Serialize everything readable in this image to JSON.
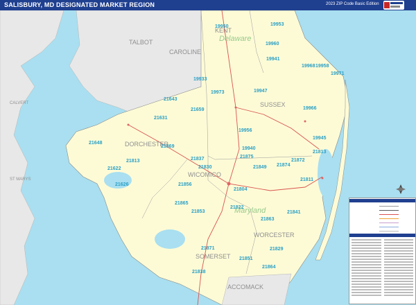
{
  "header": {
    "title": "SALISBURY, MD DESIGNATED MARKET REGION",
    "edition": "2023 ZIP Code Basic Edition"
  },
  "colors": {
    "land": "#fdfbd6",
    "other_land": "#e8e8e8",
    "water": "#a9dff0",
    "title_bar": "#1f3f8f",
    "zip_text": "#2a9fc5",
    "county_text": "#8f8f8f",
    "state_text": "#98c98a",
    "highway": "#d9534f"
  },
  "counties": [
    "KENT",
    "TALBOT",
    "CAROLINE",
    "SUSSEX",
    "DORCHESTER",
    "WICOMICO",
    "WORCESTER",
    "SOMERSET",
    "ACCOMACK",
    "CALVERT",
    "ST MARYS"
  ],
  "states": [
    "Delaware",
    "Maryland"
  ],
  "zip_codes": [
    "19953",
    "19960",
    "19950",
    "19941",
    "19968",
    "19958",
    "19971",
    "19933",
    "19973",
    "19947",
    "21643",
    "21659",
    "19966",
    "21631",
    "19956",
    "19945",
    "21648",
    "21869",
    "19940",
    "21813",
    "21837",
    "21875",
    "21874",
    "21872",
    "21813",
    "21622",
    "21830",
    "21849",
    "21811",
    "21626",
    "21856",
    "21804",
    "21865",
    "21853",
    "21822",
    "21841",
    "21863",
    "21871",
    "21829",
    "21851",
    "21864",
    "21838"
  ],
  "legend": {
    "heading": "",
    "rows": [
      "",
      "",
      "",
      "",
      "",
      "",
      "",
      ""
    ]
  }
}
